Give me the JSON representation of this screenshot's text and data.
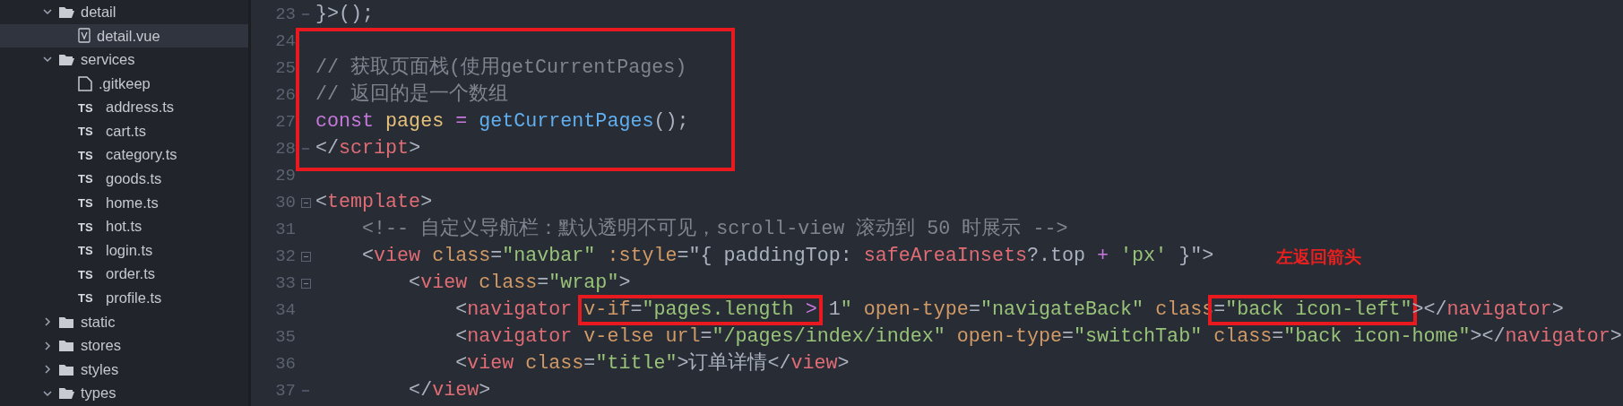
{
  "sidebar": {
    "tree": [
      {
        "kind": "folder",
        "label": "detail",
        "expanded": true,
        "selected": false,
        "children": [
          {
            "kind": "vue",
            "label": "detail.vue",
            "selected": true
          }
        ]
      },
      {
        "kind": "folder",
        "label": "services",
        "expanded": true,
        "selected": false,
        "children": [
          {
            "kind": "file",
            "label": ".gitkeep",
            "selected": false
          },
          {
            "kind": "ts",
            "badge": "TS",
            "label": "address.ts",
            "selected": false
          },
          {
            "kind": "ts",
            "badge": "TS",
            "label": "cart.ts",
            "selected": false
          },
          {
            "kind": "ts",
            "badge": "TS",
            "label": "category.ts",
            "selected": false
          },
          {
            "kind": "ts",
            "badge": "TS",
            "label": "goods.ts",
            "selected": false
          },
          {
            "kind": "ts",
            "badge": "TS",
            "label": "home.ts",
            "selected": false
          },
          {
            "kind": "ts",
            "badge": "TS",
            "label": "hot.ts",
            "selected": false
          },
          {
            "kind": "ts",
            "badge": "TS",
            "label": "login.ts",
            "selected": false
          },
          {
            "kind": "ts",
            "badge": "TS",
            "label": "order.ts",
            "selected": false
          },
          {
            "kind": "ts",
            "badge": "TS",
            "label": "profile.ts",
            "selected": false
          }
        ]
      },
      {
        "kind": "folder",
        "label": "static",
        "expanded": false,
        "selected": false
      },
      {
        "kind": "folder",
        "label": "stores",
        "expanded": false,
        "selected": false
      },
      {
        "kind": "folder",
        "label": "styles",
        "expanded": false,
        "selected": false
      },
      {
        "kind": "folder",
        "label": "types",
        "expanded": true,
        "selected": false
      }
    ]
  },
  "editor": {
    "lines": [
      {
        "number": "23",
        "fold_end": true,
        "tokens": [
          {
            "kind": "plain",
            "text": "}>();"
          }
        ]
      },
      {
        "number": "24",
        "in_box": true
      },
      {
        "number": "25",
        "in_box": true,
        "tokens": [
          {
            "kind": "comment",
            "text": "// 获取页面栈(使用getCurrentPages)"
          }
        ]
      },
      {
        "number": "26",
        "in_box": true,
        "tokens": [
          {
            "kind": "comment",
            "text": "// 返回的是一个数组"
          }
        ]
      },
      {
        "number": "27",
        "in_box": true,
        "tokens": [
          {
            "kind": "keyword",
            "text": "const "
          },
          {
            "kind": "variable",
            "text": "pages "
          },
          {
            "kind": "operator",
            "text": "= "
          },
          {
            "kind": "function",
            "text": "getCurrentPages"
          },
          {
            "kind": "plain",
            "text": "();"
          }
        ]
      },
      {
        "number": "28",
        "in_box": true,
        "fold_end": true,
        "tokens": [
          {
            "kind": "plain",
            "text": "</"
          },
          {
            "kind": "tag",
            "text": "script"
          },
          {
            "kind": "plain",
            "text": ">"
          }
        ]
      },
      {
        "number": "29"
      },
      {
        "number": "30",
        "foldable": true,
        "tokens": [
          {
            "kind": "plain",
            "text": "<"
          },
          {
            "kind": "tag",
            "text": "template"
          },
          {
            "kind": "plain",
            "text": ">"
          }
        ]
      },
      {
        "number": "31",
        "tokens": [
          {
            "kind": "comment",
            "text": "    <!-- 自定义导航栏：默认透明不可见，scroll-view 滚动到 50 时展示 -->"
          }
        ]
      },
      {
        "number": "32",
        "foldable": true,
        "note": "左返回箭头",
        "tokens": [
          {
            "kind": "plain",
            "text": "    <"
          },
          {
            "kind": "tag",
            "text": "view "
          },
          {
            "kind": "attr",
            "text": "class"
          },
          {
            "kind": "plain",
            "text": "="
          },
          {
            "kind": "string",
            "text": "\"navbar\" "
          },
          {
            "kind": "attr",
            "text": ":style"
          },
          {
            "kind": "plain",
            "text": "=\"{ paddingTop: "
          },
          {
            "kind": "tag",
            "text": "safeAreaInsets"
          },
          {
            "kind": "plain",
            "text": "?.top "
          },
          {
            "kind": "operator",
            "text": "+ "
          },
          {
            "kind": "string",
            "text": "'px'"
          },
          {
            "kind": "plain",
            "text": " }\">"
          }
        ]
      },
      {
        "number": "33",
        "foldable": true,
        "tokens": [
          {
            "kind": "plain",
            "text": "        <"
          },
          {
            "kind": "tag",
            "text": "view "
          },
          {
            "kind": "attr",
            "text": "class"
          },
          {
            "kind": "plain",
            "text": "="
          },
          {
            "kind": "string",
            "text": "\"wrap\""
          },
          {
            "kind": "plain",
            "text": ">"
          }
        ]
      },
      {
        "number": "34",
        "tokens": [
          {
            "kind": "plain",
            "text": "            <"
          },
          {
            "kind": "tag",
            "text": "navigator "
          },
          {
            "kind": "attr",
            "text": "v-if",
            "boxed": true
          },
          {
            "kind": "plain",
            "text": "=",
            "boxed": true
          },
          {
            "kind": "string",
            "text": "\"pages.length ",
            "boxed": true
          },
          {
            "kind": "operator",
            "text": ">",
            "boxed": true
          },
          {
            "kind": "plain",
            "text": " 1"
          },
          {
            "kind": "string",
            "text": "\" "
          },
          {
            "kind": "attr",
            "text": "open-type"
          },
          {
            "kind": "plain",
            "text": "="
          },
          {
            "kind": "string",
            "text": "\"navigateBack\" "
          },
          {
            "kind": "attr",
            "text": "class"
          },
          {
            "kind": "plain",
            "text": "=",
            "boxed": true
          },
          {
            "kind": "string",
            "text": "\"back icon-left\"",
            "boxed": true
          },
          {
            "kind": "plain",
            "text": "></"
          },
          {
            "kind": "tag",
            "text": "navigator"
          },
          {
            "kind": "plain",
            "text": ">"
          }
        ]
      },
      {
        "number": "35",
        "tokens": [
          {
            "kind": "plain",
            "text": "            <"
          },
          {
            "kind": "tag",
            "text": "navigator "
          },
          {
            "kind": "attr",
            "text": "v-else url"
          },
          {
            "kind": "plain",
            "text": "="
          },
          {
            "kind": "string",
            "text": "\"/pages/index/index\" "
          },
          {
            "kind": "attr",
            "text": "open-type"
          },
          {
            "kind": "plain",
            "text": "="
          },
          {
            "kind": "string",
            "text": "\"switchTab\" "
          },
          {
            "kind": "attr",
            "text": "class"
          },
          {
            "kind": "plain",
            "text": "="
          },
          {
            "kind": "string",
            "text": "\"back icon-home\""
          },
          {
            "kind": "plain",
            "text": "></"
          },
          {
            "kind": "tag",
            "text": "navigator"
          },
          {
            "kind": "plain",
            "text": ">"
          }
        ]
      },
      {
        "number": "36",
        "tokens": [
          {
            "kind": "plain",
            "text": "            <"
          },
          {
            "kind": "tag",
            "text": "view "
          },
          {
            "kind": "attr",
            "text": "class"
          },
          {
            "kind": "plain",
            "text": "="
          },
          {
            "kind": "string",
            "text": "\"title\""
          },
          {
            "kind": "plain",
            "text": ">订单详情</"
          },
          {
            "kind": "tag",
            "text": "view"
          },
          {
            "kind": "plain",
            "text": ">"
          }
        ]
      },
      {
        "number": "37",
        "fold_end": true,
        "tokens": [
          {
            "kind": "plain",
            "text": "        </"
          },
          {
            "kind": "tag",
            "text": "view"
          },
          {
            "kind": "plain",
            "text": ">"
          }
        ]
      }
    ]
  }
}
